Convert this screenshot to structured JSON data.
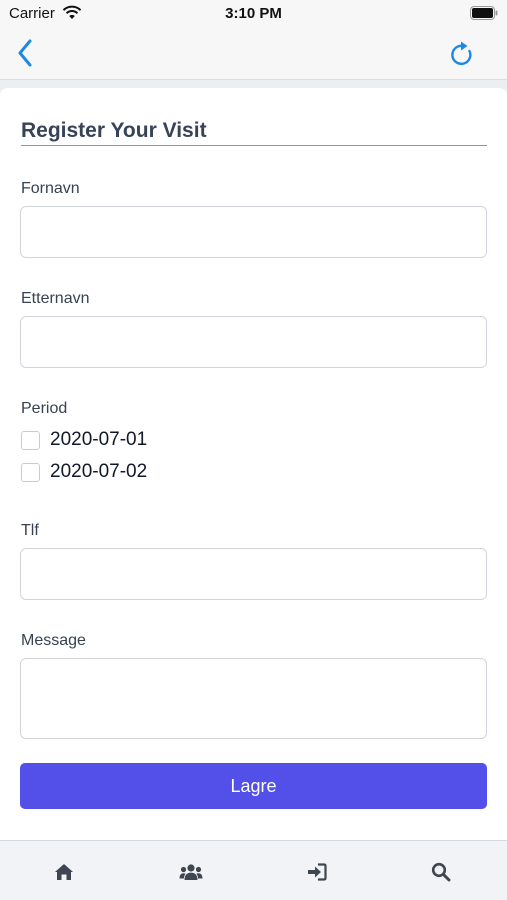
{
  "status_bar": {
    "carrier": "Carrier",
    "time": "3:10 PM"
  },
  "nav": {
    "back_icon": "chevron-left-icon",
    "refresh_icon": "refresh-icon",
    "accent_color": "#1e88e5"
  },
  "form": {
    "title": "Register Your Visit",
    "first_name": {
      "label": "Fornavn",
      "value": ""
    },
    "last_name": {
      "label": "Etternavn",
      "value": ""
    },
    "period": {
      "label": "Period",
      "options": [
        "2020-07-01",
        "2020-07-02"
      ]
    },
    "phone": {
      "label": "Tlf",
      "value": ""
    },
    "message": {
      "label": "Message",
      "value": ""
    },
    "submit_label": "Lagre",
    "submit_color": "#5250e8"
  },
  "tabs": [
    {
      "icon": "home-icon"
    },
    {
      "icon": "users-icon"
    },
    {
      "icon": "sign-in-icon"
    },
    {
      "icon": "search-icon"
    }
  ]
}
